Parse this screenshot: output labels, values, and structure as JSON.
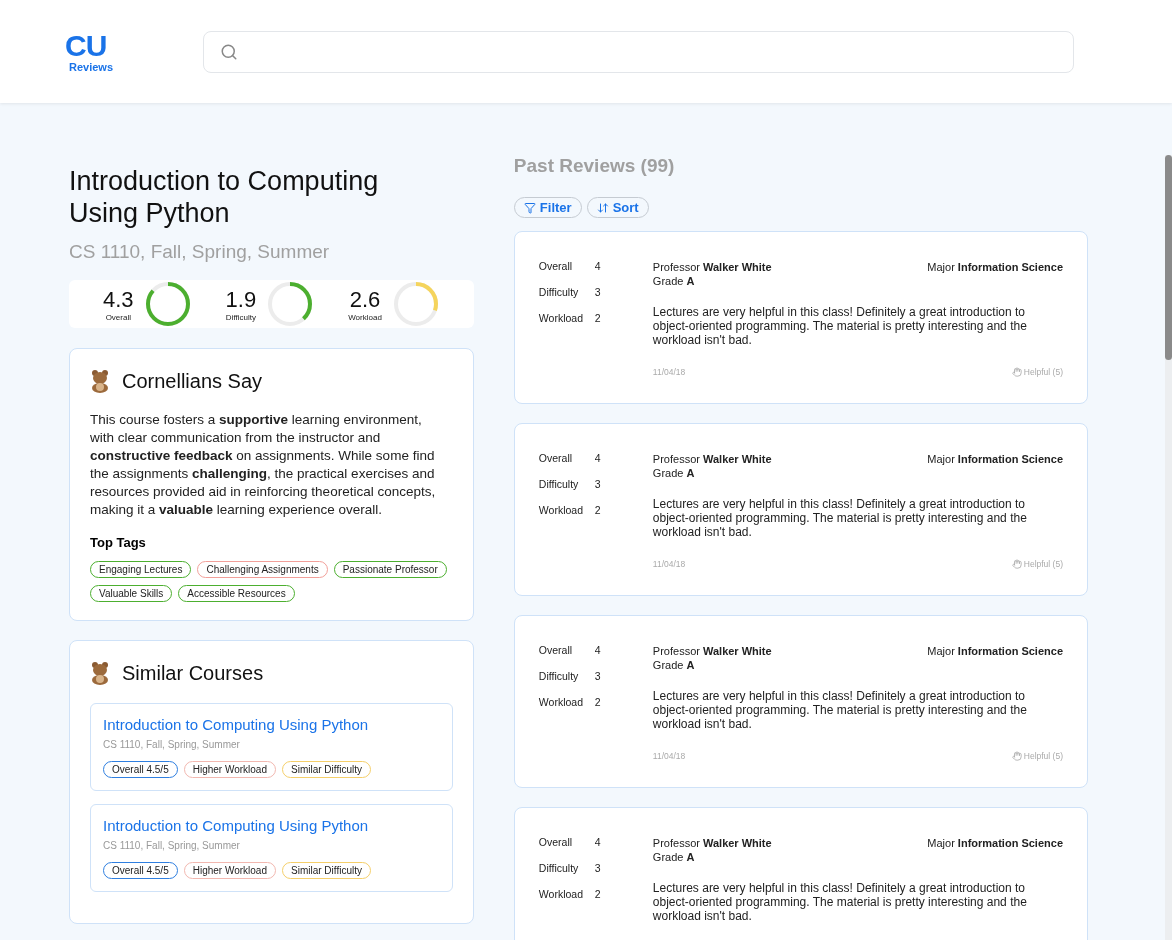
{
  "header": {
    "logo": {
      "mark": "CU",
      "text": "Reviews"
    }
  },
  "course": {
    "title": "Introduction to Computing Using Python",
    "subtitle": "CS 1110, Fall, Spring, Summer",
    "metrics": [
      {
        "value": "4.3",
        "label": "Overall",
        "level": 0.86,
        "color": "#4caf2f"
      },
      {
        "value": "1.9",
        "label": "Difficulty",
        "level": 0.38,
        "color": "#4caf2f"
      },
      {
        "value": "2.6",
        "label": "Workload",
        "level": 0.3,
        "color": "#f5d45c"
      }
    ]
  },
  "summary": {
    "title": "Cornellians Say",
    "text": "This course fosters a **supportive** learning environment, with clear communication from the instructor and **constructive feedback** on assignments. While some find the assignments **challenging**, the practical exercises and resources provided aid in reinforcing theoretical concepts, making it a **valuable** learning experience overall.",
    "tags_title": "Top Tags",
    "tags": [
      {
        "label": "Engaging Lectures",
        "color": "#4caf2f"
      },
      {
        "label": "Challenging Assignments",
        "color": "#f2a09a"
      },
      {
        "label": "Passionate Professor",
        "color": "#4caf2f"
      },
      {
        "label": "Valuable Skills",
        "color": "#4caf2f"
      },
      {
        "label": "Accessible Resources",
        "color": "#4caf2f"
      }
    ]
  },
  "similar": {
    "title": "Similar Courses",
    "courses": [
      {
        "title": "Introduction to Computing Using Python",
        "subtitle": "CS 1110, Fall, Spring, Summer",
        "tags": [
          {
            "label": "Overall 4.5/5",
            "color": "#2f7fe0"
          },
          {
            "label": "Higher Workload",
            "color": "#f2b8b0"
          },
          {
            "label": "Similar Difficulty",
            "color": "#f5cf6a"
          }
        ]
      },
      {
        "title": "Introduction to Computing Using Python",
        "subtitle": "CS 1110, Fall, Spring, Summer",
        "tags": [
          {
            "label": "Overall 4.5/5",
            "color": "#2f7fe0"
          },
          {
            "label": "Higher Workload",
            "color": "#f2b8b0"
          },
          {
            "label": "Similar Difficulty",
            "color": "#f5cf6a"
          }
        ]
      }
    ]
  },
  "reviews": {
    "title": "Past Reviews (99)",
    "buttons": [
      {
        "label": "Filter",
        "kind": "filter"
      },
      {
        "label": "Sort",
        "kind": "sort"
      }
    ],
    "items": [
      {
        "scores": [
          {
            "label": "Overall",
            "value": "4"
          },
          {
            "label": "Difficulty",
            "value": "3"
          },
          {
            "label": "Workload",
            "value": "2"
          }
        ],
        "professor": "Professor **Walker White**",
        "grade": "Grade **A**",
        "major": "Major **Information Science**",
        "text": "Lectures are very helpful in this class! Definitely a great introduction to object-oriented programming. The material is pretty interesting and the workload isn't bad.",
        "date": "11/04/18",
        "helpful": "Helpful (5)"
      },
      {
        "scores": [
          {
            "label": "Overall",
            "value": "4"
          },
          {
            "label": "Difficulty",
            "value": "3"
          },
          {
            "label": "Workload",
            "value": "2"
          }
        ],
        "professor": "Professor **Walker White**",
        "grade": "Grade **A**",
        "major": "Major **Information Science**",
        "text": "Lectures are very helpful in this class! Definitely a great introduction to object-oriented programming. The material is pretty interesting and the workload isn't bad.",
        "date": "11/04/18",
        "helpful": "Helpful (5)"
      },
      {
        "scores": [
          {
            "label": "Overall",
            "value": "4"
          },
          {
            "label": "Difficulty",
            "value": "3"
          },
          {
            "label": "Workload",
            "value": "2"
          }
        ],
        "professor": "Professor **Walker White**",
        "grade": "Grade **A**",
        "major": "Major **Information Science**",
        "text": "Lectures are very helpful in this class! Definitely a great introduction to object-oriented programming. The material is pretty interesting and the workload isn't bad.",
        "date": "11/04/18",
        "helpful": "Helpful (5)"
      },
      {
        "scores": [
          {
            "label": "Overall",
            "value": "4"
          },
          {
            "label": "Difficulty",
            "value": "3"
          },
          {
            "label": "Workload",
            "value": "2"
          }
        ],
        "professor": "Professor **Walker White**",
        "grade": "Grade **A**",
        "major": "Major **Information Science**",
        "text": "Lectures are very helpful in this class! Definitely a great introduction to object-oriented programming. The material is pretty interesting and the workload isn't bad."
      }
    ]
  }
}
